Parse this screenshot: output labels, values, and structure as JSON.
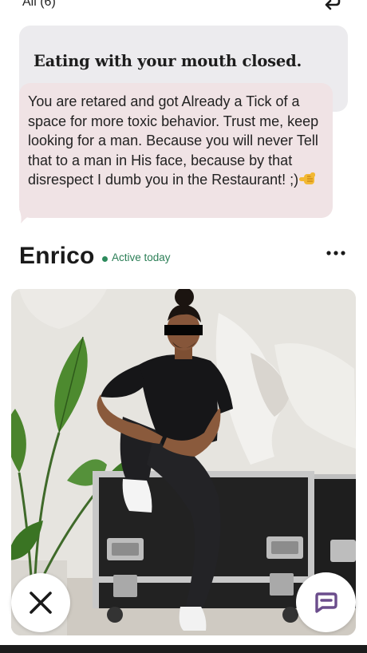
{
  "header": {
    "filter_label": "All (6)",
    "back_icon": "return-arrow-icon"
  },
  "prompt": {
    "text": "Eating with your mouth closed."
  },
  "reply": {
    "text": "You are retared and got Already a Tick of a space for more toxic behavior. Trust me, keep looking for a man. Because you will never Tell that to a man in His face, because by that disrespect I dumb you in the Restaurant! ;)",
    "emoji_icon": "pointing-fist-emoji"
  },
  "profile": {
    "name": "Enrico",
    "status": "Active today",
    "status_color": "#2c8a5c",
    "more_icon": "more-dots-icon"
  },
  "photo": {
    "subject": "profile-photo"
  },
  "actions": {
    "dismiss_icon": "close-x-icon",
    "chat_icon": "chat-bubble-icon",
    "chat_color": "#6b4d8c"
  }
}
